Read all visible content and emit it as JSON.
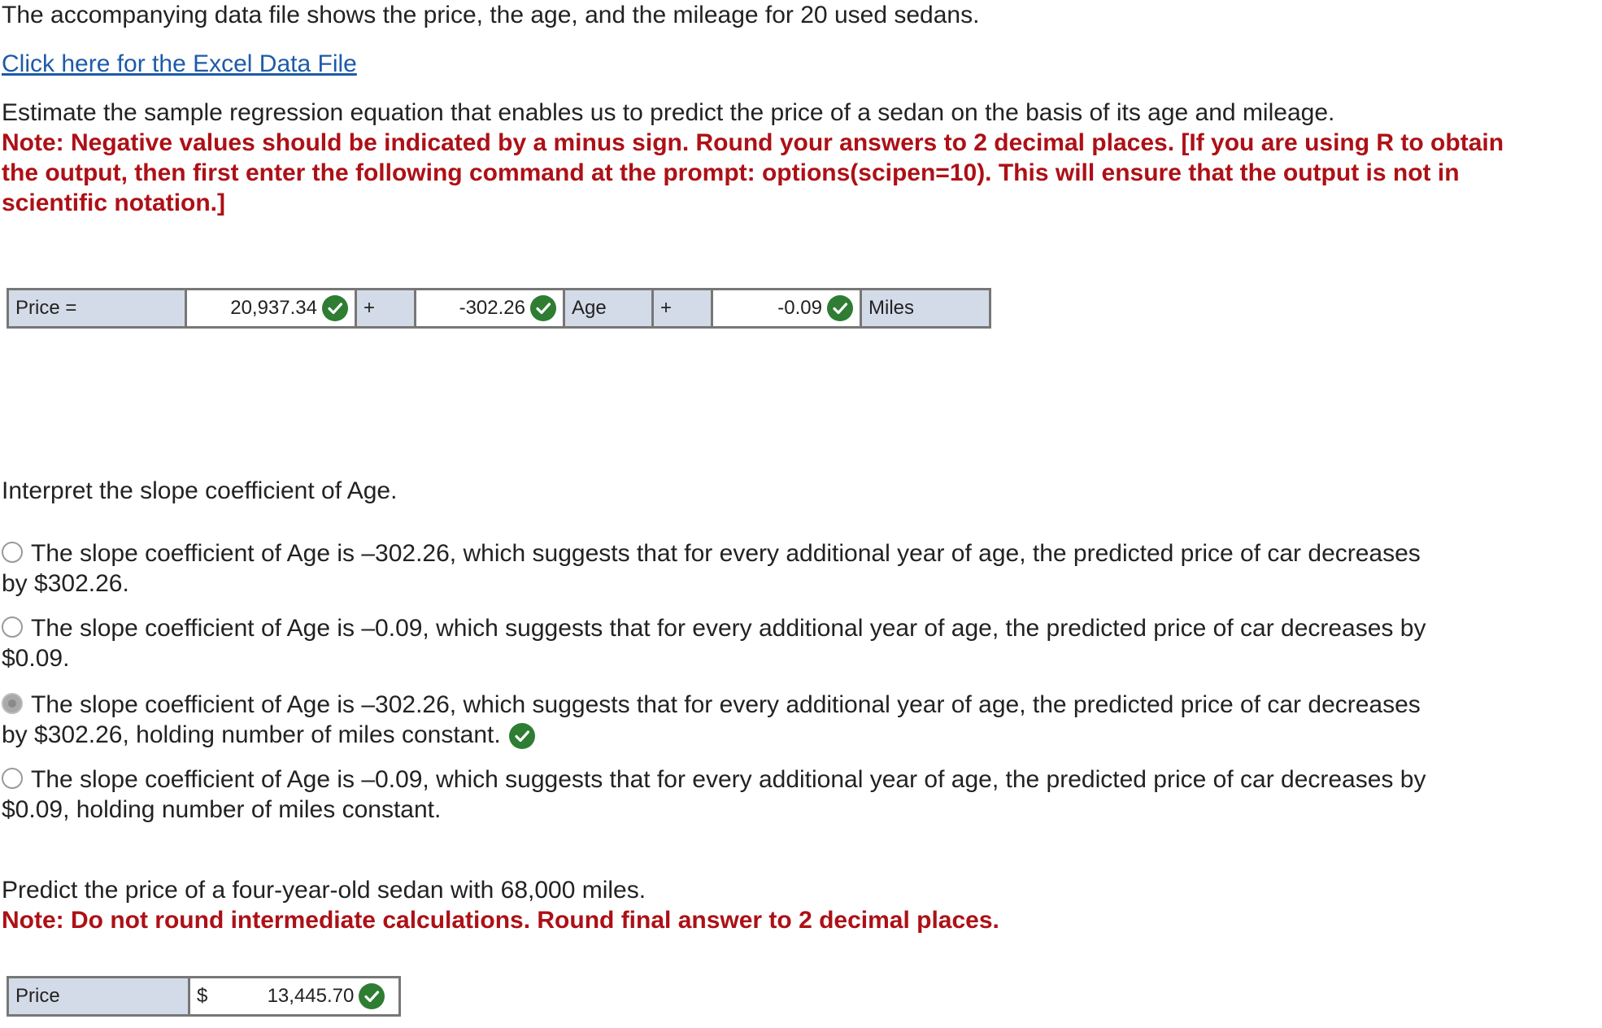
{
  "intro": "The accompanying data file shows the price, the age, and the mileage for 20 used sedans.",
  "data_link": "Click here for the Excel Data File",
  "q1": {
    "prompt": "Estimate the sample regression equation that enables us to predict the price of a sedan on the basis of its age and mileage.",
    "note_line1": "Note: Negative values should be indicated by a minus sign. Round your answers to 2 decimal places. [If you are using R to obtain",
    "note_line2": "the output, then first enter the following command at the prompt: options(scipen=10). This will ensure that the output is not in",
    "note_line3": "scientific notation.]",
    "equation": {
      "label": "Price =",
      "intercept": "20,937.34",
      "plus1": "+",
      "age_coef": "-302.26",
      "age_label": "Age",
      "plus2": "+",
      "miles_coef": "-0.09",
      "miles_label": "Miles"
    }
  },
  "q2": {
    "prompt": "Interpret the slope coefficient of Age.",
    "options": [
      {
        "line1": "The slope coefficient of Age is –302.26, which suggests that for every additional year of age, the predicted price of car decreases",
        "line2": "by $302.26."
      },
      {
        "line1": "The slope coefficient of Age is –0.09, which suggests that for every additional year of age, the predicted price of car decreases by",
        "line2": "$0.09."
      },
      {
        "line1": "The slope coefficient of Age is –302.26, which suggests that for every additional year of age, the predicted price of car decreases",
        "line2": "by $302.26, holding number of miles constant."
      },
      {
        "line1": "The slope coefficient of Age is –0.09, which suggests that for every additional year of age, the predicted price of car decreases by",
        "line2": "$0.09, holding number of miles constant."
      }
    ],
    "selected_index": 2
  },
  "q3": {
    "prompt": "Predict the price of a four-year-old sedan with 68,000 miles.",
    "note": "Note: Do not round intermediate calculations. Round final answer to 2 decimal places.",
    "label": "Price",
    "currency": "$",
    "value": "13,445.70"
  },
  "icons": {
    "check": "check-circle-icon",
    "check_color": "#2e7d32",
    "note_color": "#ad1016",
    "link_color": "#1e5aa8"
  }
}
